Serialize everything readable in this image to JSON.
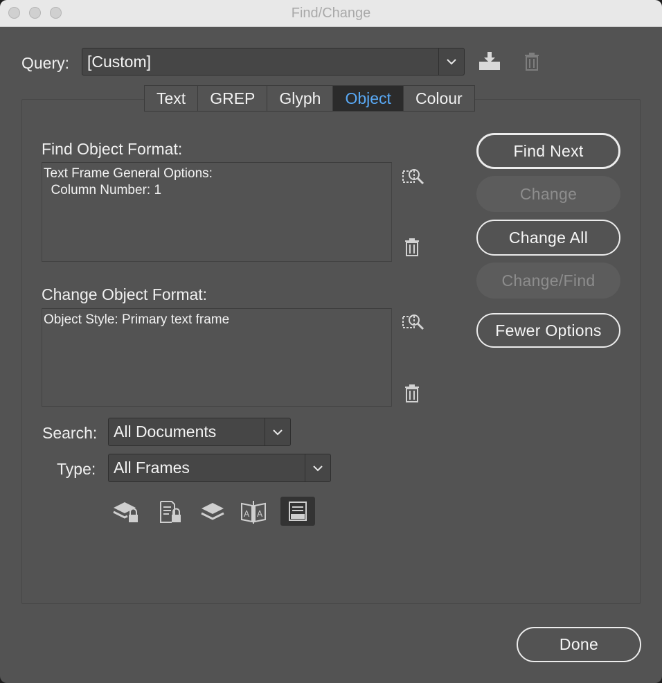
{
  "window": {
    "title": "Find/Change"
  },
  "query": {
    "label": "Query:",
    "value": "[Custom]"
  },
  "tabs": [
    {
      "label": "Text",
      "active": false
    },
    {
      "label": "GREP",
      "active": false
    },
    {
      "label": "Glyph",
      "active": false
    },
    {
      "label": "Object",
      "active": true
    },
    {
      "label": "Colour",
      "active": false
    }
  ],
  "find": {
    "label": "Find Object Format:",
    "lines": "Text Frame General Options:\n  Column Number: 1"
  },
  "change": {
    "label": "Change Object Format:",
    "lines": "Object Style: Primary text frame"
  },
  "search": {
    "label": "Search:",
    "value": "All Documents"
  },
  "type": {
    "label": "Type:",
    "value": "All Frames"
  },
  "buttons": {
    "find_next": "Find Next",
    "change": "Change",
    "change_all": "Change All",
    "change_find": "Change/Find",
    "fewer_options": "Fewer Options",
    "done": "Done"
  },
  "icons": {
    "save_query": "save-query-icon",
    "delete_query": "trash-icon",
    "specify_find": "specify-format-icon",
    "clear_find": "trash-icon",
    "specify_change": "specify-format-icon",
    "clear_change": "trash-icon",
    "options": [
      "include-locked-layers-icon",
      "include-locked-stories-icon",
      "include-hidden-layers-icon",
      "include-master-pages-icon",
      "include-footnotes-icon"
    ]
  },
  "colors": {
    "accent_tab_text": "#59a9f5",
    "window_bg": "#535353",
    "field_bg": "#464646"
  }
}
